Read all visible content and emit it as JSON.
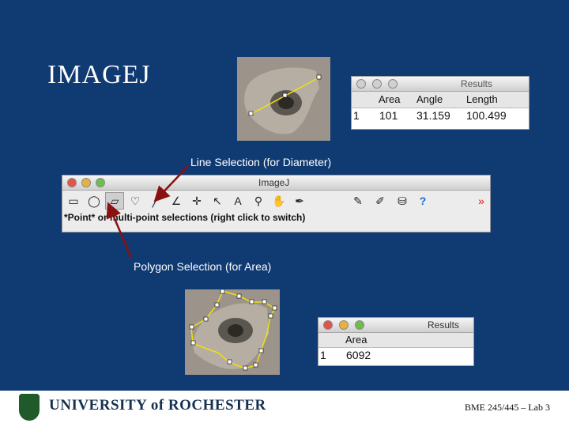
{
  "slide": {
    "title": "IMAGEJ",
    "caption_line": "Line Selection (for Diameter)",
    "caption_polygon": "Polygon Selection (for Area)"
  },
  "results_top": {
    "title": "Results",
    "headers": [
      "Area",
      "Angle",
      "Length"
    ],
    "row_index": "1",
    "values": [
      "101",
      "31.159",
      "100.499"
    ]
  },
  "results_bottom": {
    "title": "Results",
    "headers": [
      "Area"
    ],
    "row_index": "1",
    "values": [
      "6092"
    ]
  },
  "imagej": {
    "title": "ImageJ",
    "status": "*Point* or multi-point selections (right click to switch)",
    "tools": [
      {
        "name": "rectangle-tool-icon",
        "glyph": "▭"
      },
      {
        "name": "oval-tool-icon",
        "glyph": "◯"
      },
      {
        "name": "polygon-tool-icon",
        "glyph": "▱"
      },
      {
        "name": "freehand-tool-icon",
        "glyph": "♡"
      },
      {
        "name": "line-tool-icon",
        "glyph": "╱"
      },
      {
        "name": "angle-tool-icon",
        "glyph": "∠"
      },
      {
        "name": "point-tool-icon",
        "glyph": "✛"
      },
      {
        "name": "wand-tool-icon",
        "glyph": "↖"
      },
      {
        "name": "text-tool-icon",
        "glyph": "A"
      },
      {
        "name": "magnifier-tool-icon",
        "glyph": "⚲"
      },
      {
        "name": "hand-tool-icon",
        "glyph": "✋"
      },
      {
        "name": "dropper-tool-icon",
        "glyph": "✒"
      },
      {
        "name": "pencil-tool-icon",
        "glyph": "✎"
      },
      {
        "name": "brush-tool-icon",
        "glyph": "✐"
      },
      {
        "name": "flood-fill-tool-icon",
        "glyph": "⛁"
      },
      {
        "name": "help-tool-icon",
        "glyph": "?"
      },
      {
        "name": "more-tools-icon",
        "glyph": "»"
      }
    ]
  },
  "footer": {
    "university": "UNIVERSITY of ROCHESTER",
    "course": "BME 245/445 – Lab 3"
  },
  "colors": {
    "background": "#0f3a72",
    "selection": "#f0e010",
    "arrow": "#8b1010"
  }
}
